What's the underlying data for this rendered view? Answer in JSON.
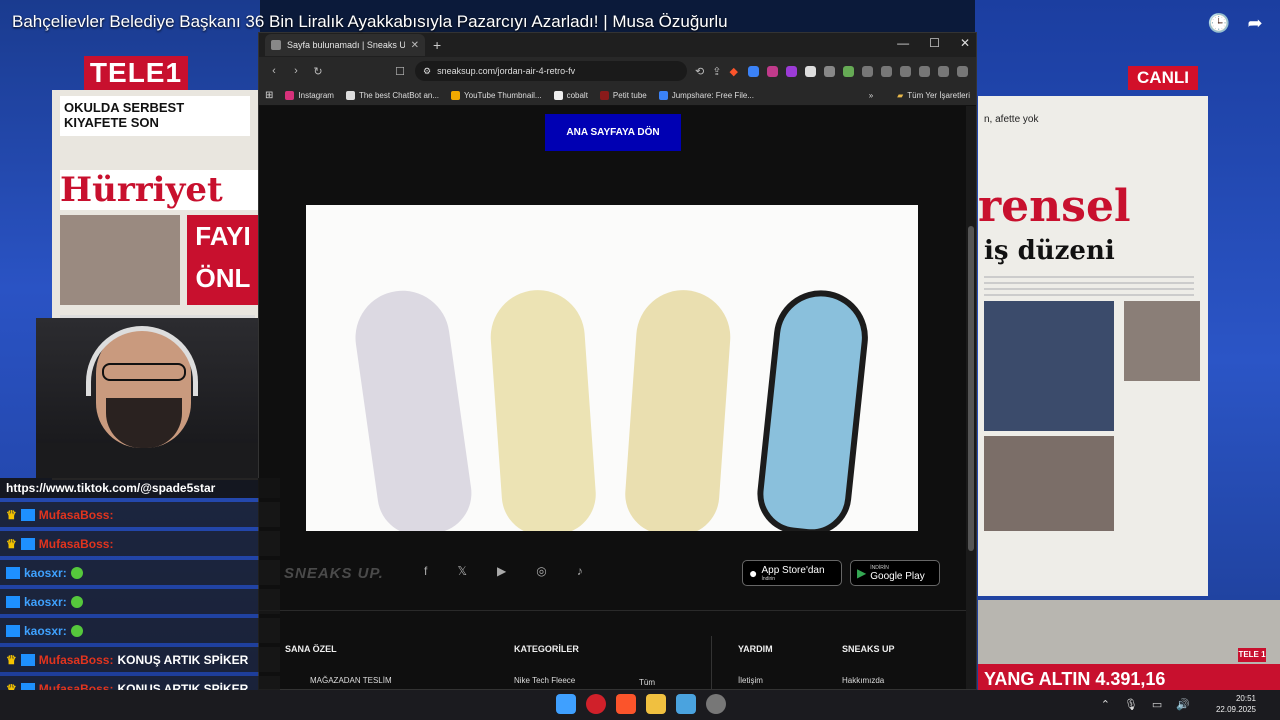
{
  "video": {
    "title": "Bahçelievler Belediye Başkanı 36 Bin Liralık Ayakkabısıyla Pazarcıyı Azarladı! | Musa Özuğurlu"
  },
  "overlay": {
    "channel_logo": "TELE1",
    "live_badge": "CANLI",
    "newspaper_left_top": "OKULDA SERBEST KIYAFETE SON",
    "newspaper_left_name": "Hürriyet",
    "newspaper_left_red": "FAYI ÖNL",
    "newspaper_right_name": "rensel",
    "newspaper_right_headline": "iş düzeni",
    "newspaper_right_top": "n, afette yok",
    "ticker": "YANG ALTIN 4.391,16",
    "small_logo": "TELE 1"
  },
  "chat": {
    "url_line": "https://www.tiktok.com/@spade5star",
    "rows": [
      {
        "user": "MufasaBoss:",
        "message": ""
      },
      {
        "user": "MufasaBoss:",
        "message": ""
      },
      {
        "user": "kaosxr:",
        "message": ""
      },
      {
        "user": "kaosxr:",
        "message": ""
      },
      {
        "user": "kaosxr:",
        "message": ""
      },
      {
        "user": "MufasaBoss:",
        "message": "KONUŞ ARTIK SPİKER"
      },
      {
        "user": "MufasaBoss:",
        "message": "KONUŞ ARTIK SPİKER"
      }
    ]
  },
  "browser": {
    "tab_title": "Sayfa bulunamadı | Sneaks Up",
    "url": "sneaksup.com/jordan-air-4-retro-fv",
    "bookmarks": [
      {
        "label": "Instagram",
        "color": "#d6317a"
      },
      {
        "label": "The best ChatBot an...",
        "color": "#dddddd"
      },
      {
        "label": "YouTube Thumbnail...",
        "color": "#f2a900"
      },
      {
        "label": "cobalt",
        "color": "#eeeeee"
      },
      {
        "label": "Petit tube",
        "color": "#8a1a1a"
      },
      {
        "label": "Jumpshare: Free File...",
        "color": "#3b82f6"
      }
    ],
    "bookmarks_more": "»",
    "all_bookmarks": "Tüm Yer İşaretleri"
  },
  "page": {
    "home_button": "ANA SAYFAYA DÖN",
    "brand": "SNEAKS UP.",
    "social": [
      "f",
      "𝕏",
      "▶",
      "◎",
      "♪"
    ],
    "app_store": {
      "sub": "",
      "main": "App Store'dan",
      "sub2": "İndirin"
    },
    "google_play": {
      "sub": "İNDİRİN",
      "main": "Google Play"
    },
    "footer": {
      "col1_head": "SANA ÖZEL",
      "col1_item": "MAĞAZADAN TESLİM",
      "col2_head": "KATEGORİLER",
      "col2_item1": "Nike Tech Fleece",
      "col2_item2": "Tüm",
      "col3_head": "YARDIM",
      "col3_item": "İletişim",
      "col4_head": "SNEAKS UP",
      "col4_item": "Hakkımızda"
    }
  },
  "taskbar": {
    "time": "20:51",
    "date": "22.09.2025"
  },
  "colors": {
    "accent_blue": "#0000b3",
    "tele1_red": "#c8102e"
  }
}
